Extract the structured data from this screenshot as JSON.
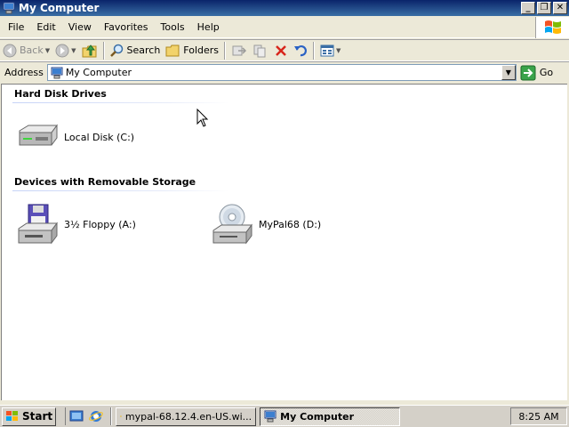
{
  "window": {
    "title": "My Computer",
    "controls": {
      "minimize": "_",
      "restore": "❐",
      "close": "✕"
    }
  },
  "menu": [
    "File",
    "Edit",
    "View",
    "Favorites",
    "Tools",
    "Help"
  ],
  "toolbar": {
    "back_label": "Back",
    "search_label": "Search",
    "folders_label": "Folders"
  },
  "address": {
    "label": "Address",
    "value": "My Computer",
    "go_label": "Go"
  },
  "groups": [
    {
      "header": "Hard Disk Drives",
      "items": [
        {
          "label": "Local Disk (C:)",
          "icon": "hard-disk-icon"
        }
      ]
    },
    {
      "header": "Devices with Removable Storage",
      "items": [
        {
          "label": "3½ Floppy (A:)",
          "icon": "floppy-drive-icon"
        },
        {
          "label": "MyPal68 (D:)",
          "icon": "cd-drive-icon"
        }
      ]
    }
  ],
  "taskbar": {
    "start_label": "Start",
    "tasks": [
      {
        "label": "mypal-68.12.4.en-US.wi...",
        "active": false
      },
      {
        "label": "My Computer",
        "active": true
      }
    ],
    "clock": "8:25 AM"
  },
  "colors": {
    "titlebar_start": "#0a246a",
    "titlebar_end": "#3a6ea5",
    "window_bg": "#ece9d8",
    "content_bg": "#ffffff"
  }
}
